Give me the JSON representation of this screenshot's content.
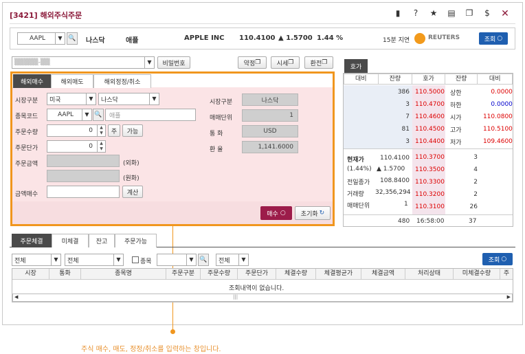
{
  "window": {
    "title": "[3421] 해외주식주문"
  },
  "toolbar_icons": [
    "chat-icon",
    "help-icon",
    "star-icon",
    "print-icon",
    "copy-icon",
    "dollar-icon",
    "close-icon"
  ],
  "symbol_bar": {
    "code": "AAPL",
    "market": "나스닥",
    "name_kr": "애플",
    "name_en": "APPLE INC",
    "price": "110.4100",
    "change": "▲ 1.5700",
    "change_pct": "1.44 %",
    "delay": "15분 지연",
    "provider": "REUTERS",
    "query_label": "조회"
  },
  "account": {
    "account_masked": "▒▒▒▒▒-▒▒",
    "password_label": "비밀번호",
    "terms_label": "약정",
    "quote_label": "시세",
    "exchange_label": "환전"
  },
  "order_tabs": [
    "해외매수",
    "해외매도",
    "해외정정/취소"
  ],
  "order_form": {
    "market_label": "시장구분",
    "country": "미국",
    "exchange": "나스닥",
    "code_label": "종목코드",
    "code_value": "AAPL",
    "code_name": "애플",
    "qty_label": "주문수량",
    "qty_value": "0",
    "qty_btn": "주",
    "possible_btn": "가능",
    "price_label": "주문단가",
    "price_value": "0",
    "amount_label": "주문금액",
    "foreign_label": "(외화)",
    "won_label": "(원화)",
    "buy_amount_label": "금액매수",
    "calc_btn": "계산",
    "right_market_label": "시장구분",
    "right_market_value": "나스닥",
    "unit_label": "매매단위",
    "unit_value": "1",
    "currency_label": "통    화",
    "currency_value": "USD",
    "rate_label": "환    율",
    "rate_value": "1,141.6000",
    "buy_btn": "매수",
    "reset_btn": "초기화"
  },
  "orderbook": {
    "tab": "호가",
    "headers": [
      "대비",
      "잔량",
      "호가",
      "잔량",
      "대비"
    ],
    "ask_rows": [
      {
        "qty": "386",
        "price": "110.5000",
        "label": "상한",
        "val": "0.0000",
        "val_color": "red"
      },
      {
        "qty": "3",
        "price": "110.4700",
        "label": "하한",
        "val": "0.0000",
        "val_color": "blue"
      },
      {
        "qty": "7",
        "price": "110.4600",
        "label": "시가",
        "val": "110.0800",
        "val_color": "red"
      },
      {
        "qty": "81",
        "price": "110.4500",
        "label": "고가",
        "val": "110.5100",
        "val_color": "red"
      },
      {
        "qty": "3",
        "price": "110.4400",
        "label": "저가",
        "val": "109.4600",
        "val_color": "red"
      }
    ],
    "bid_rows": [
      {
        "price": "110.3700",
        "qty": "3"
      },
      {
        "price": "110.3500",
        "qty": "4"
      },
      {
        "price": "110.3300",
        "qty": "2"
      },
      {
        "price": "110.3200",
        "qty": "2"
      },
      {
        "price": "110.3100",
        "qty": "26"
      }
    ],
    "info": {
      "cur_label": "현재가",
      "cur_val": "110.4100",
      "pct": "(1.44%)",
      "chg": "▲ 1.5700",
      "prev_label": "전일종가",
      "prev_val": "108.8400",
      "vol_label": "거래량",
      "vol_val": "32,356,294",
      "unit_label": "매매단위",
      "unit_val": "1"
    },
    "footer": {
      "ask_total": "480",
      "time": "16:58:00",
      "bid_total": "37"
    }
  },
  "bottom_tabs": [
    "주문체결",
    "미체결",
    "잔고",
    "주문가능"
  ],
  "filters": {
    "f1": "전체",
    "f2": "전체",
    "chk_label": "종목",
    "f3": "전체",
    "query": "조회"
  },
  "grid": {
    "headers": [
      "시장",
      "통화",
      "종목명",
      "주문구분",
      "주문수량",
      "주문단가",
      "체결수량",
      "체결평균가",
      "체결금액",
      "처리상태",
      "미체결수량",
      "주"
    ],
    "empty": "조회내역이 없습니다."
  },
  "caption": "주식 매수, 매도, 정정/취소를 입력하는 창입니다.",
  "colors": {
    "accent": "#8b1a3a",
    "highlight": "#f0961e",
    "form_bg": "#fbe4e6",
    "orderbook_bg": "#f3e6ee"
  }
}
